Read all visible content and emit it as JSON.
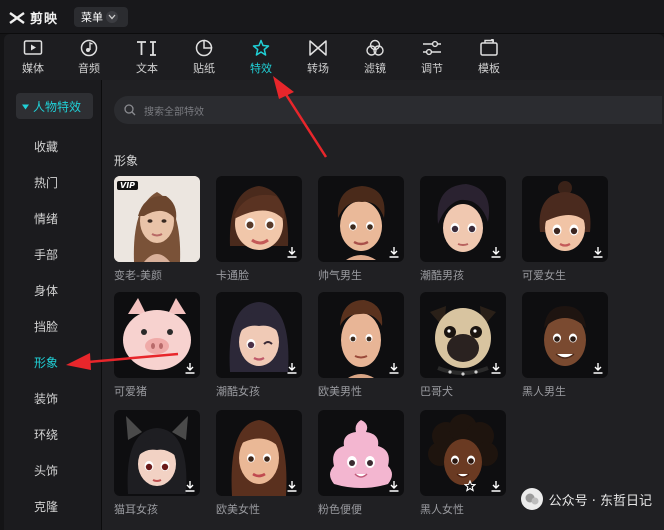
{
  "app": {
    "name": "剪映",
    "menu_label": "菜单"
  },
  "toolbar": [
    {
      "id": "media",
      "label": "媒体",
      "icon": "media-icon"
    },
    {
      "id": "audio",
      "label": "音频",
      "icon": "audio-icon"
    },
    {
      "id": "text",
      "label": "文本",
      "icon": "text-icon"
    },
    {
      "id": "sticker",
      "label": "贴纸",
      "icon": "sticker-icon"
    },
    {
      "id": "effects",
      "label": "特效",
      "icon": "effects-icon",
      "active": true
    },
    {
      "id": "transition",
      "label": "转场",
      "icon": "transition-icon"
    },
    {
      "id": "filter",
      "label": "滤镜",
      "icon": "filter-icon"
    },
    {
      "id": "adjust",
      "label": "调节",
      "icon": "adjust-icon"
    },
    {
      "id": "template",
      "label": "模板",
      "icon": "template-icon"
    }
  ],
  "sidebar": {
    "category": "人物特效",
    "items": [
      {
        "label": "收藏"
      },
      {
        "label": "热门"
      },
      {
        "label": "情绪"
      },
      {
        "label": "手部"
      },
      {
        "label": "身体"
      },
      {
        "label": "挡脸"
      },
      {
        "label": "形象",
        "active": true
      },
      {
        "label": "装饰"
      },
      {
        "label": "环绕"
      },
      {
        "label": "头饰"
      },
      {
        "label": "克隆"
      }
    ]
  },
  "search": {
    "placeholder": "搜索全部特效"
  },
  "section": {
    "title": "形象"
  },
  "effects": [
    {
      "label": "变老-美颜",
      "vip": "VIP"
    },
    {
      "label": "卡通脸"
    },
    {
      "label": "帅气男生"
    },
    {
      "label": "潮酷男孩"
    },
    {
      "label": "可爱女生"
    },
    {
      "label": "可爱猪"
    },
    {
      "label": "潮酷女孩"
    },
    {
      "label": "欧美男性"
    },
    {
      "label": "巴哥犬"
    },
    {
      "label": "黑人男生"
    },
    {
      "label": "猫耳女孩"
    },
    {
      "label": "欧美女性"
    },
    {
      "label": "粉色便便"
    },
    {
      "label": "黑人女性"
    }
  ],
  "watermark": {
    "text": "公众号 · 东哲日记"
  },
  "colors": {
    "accent": "#20d0d6",
    "annotation_arrow": "#e8262b"
  }
}
